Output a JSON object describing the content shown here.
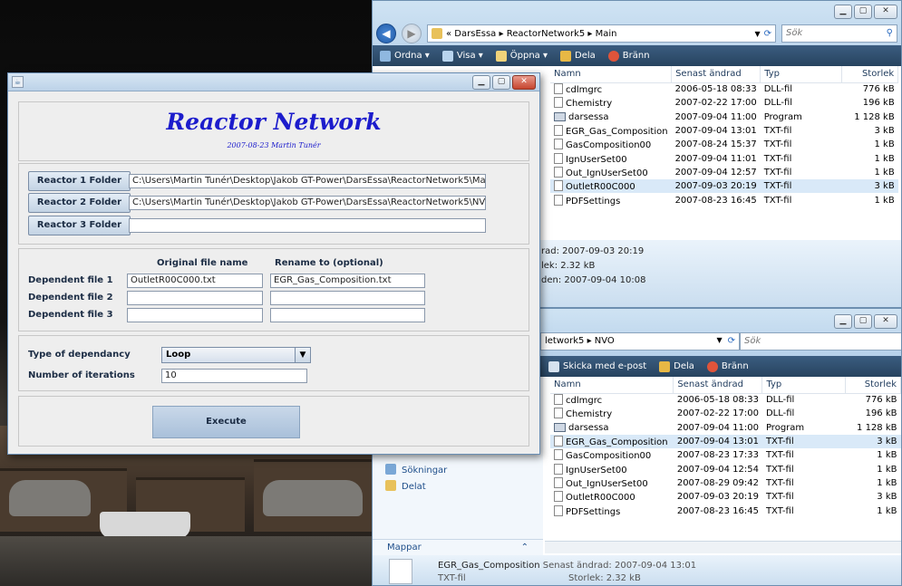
{
  "explorer_main": {
    "breadcrumb": "« DarsEssa ▸ ReactorNetwork5 ▸ Main",
    "search_placeholder": "Sök",
    "toolbar": [
      "Ordna ▾",
      "Visa ▾",
      "Öppna ▾",
      "Dela",
      "Bränn"
    ],
    "columns": [
      "Namn",
      "Senast ändrad",
      "Typ",
      "Storlek"
    ],
    "rows": [
      {
        "name": "cdlmgrc",
        "date": "2006-05-18 08:33",
        "type": "DLL-fil",
        "size": "776 kB"
      },
      {
        "name": "Chemistry",
        "date": "2007-02-22 17:00",
        "type": "DLL-fil",
        "size": "196 kB"
      },
      {
        "name": "darsessa",
        "date": "2007-09-04 11:00",
        "type": "Program",
        "size": "1 128 kB"
      },
      {
        "name": "EGR_Gas_Composition",
        "date": "2007-09-04 13:01",
        "type": "TXT-fil",
        "size": "3 kB"
      },
      {
        "name": "GasComposition00",
        "date": "2007-08-24 15:37",
        "type": "TXT-fil",
        "size": "1 kB"
      },
      {
        "name": "IgnUserSet00",
        "date": "2007-09-04 11:01",
        "type": "TXT-fil",
        "size": "1 kB"
      },
      {
        "name": "Out_IgnUserSet00",
        "date": "2007-09-04 12:57",
        "type": "TXT-fil",
        "size": "1 kB"
      },
      {
        "name": "OutletR00C000",
        "date": "2007-09-03 20:19",
        "type": "TXT-fil",
        "size": "3 kB"
      },
      {
        "name": "PDFSettings",
        "date": "2007-08-23 16:45",
        "type": "TXT-fil",
        "size": "1 kB"
      }
    ],
    "details": [
      "rad: 2007-09-03 20:19",
      "lek: 2.32 kB",
      "den: 2007-09-04 10:08"
    ]
  },
  "explorer_nvo": {
    "breadcrumb": "letwork5 ▸ NVO",
    "search_placeholder": "Sök",
    "toolbar": [
      "Skicka med e-post",
      "Dela",
      "Bränn"
    ],
    "columns": [
      "Namn",
      "Senast ändrad",
      "Typ",
      "Storlek"
    ],
    "rows": [
      {
        "name": "cdlmgrc",
        "date": "2006-05-18 08:33",
        "type": "DLL-fil",
        "size": "776 kB"
      },
      {
        "name": "Chemistry",
        "date": "2007-02-22 17:00",
        "type": "DLL-fil",
        "size": "196 kB"
      },
      {
        "name": "darsessa",
        "date": "2007-09-04 11:00",
        "type": "Program",
        "size": "1 128 kB"
      },
      {
        "name": "EGR_Gas_Composition",
        "date": "2007-09-04 13:01",
        "type": "TXT-fil",
        "size": "3 kB"
      },
      {
        "name": "GasComposition00",
        "date": "2007-08-23 17:33",
        "type": "TXT-fil",
        "size": "1 kB"
      },
      {
        "name": "IgnUserSet00",
        "date": "2007-09-04 12:54",
        "type": "TXT-fil",
        "size": "1 kB"
      },
      {
        "name": "Out_IgnUserSet00",
        "date": "2007-08-29 09:42",
        "type": "TXT-fil",
        "size": "1 kB"
      },
      {
        "name": "OutletR00C000",
        "date": "2007-09-03 20:19",
        "type": "TXT-fil",
        "size": "3 kB"
      },
      {
        "name": "PDFSettings",
        "date": "2007-08-23 16:45",
        "type": "TXT-fil",
        "size": "1 kB"
      }
    ],
    "nav_items": [
      "Sökningar",
      "Delat"
    ],
    "folders_label": "Mappar",
    "details": {
      "name": "EGR_Gas_Composition",
      "modified": "Senast ändrad: 2007-09-04 13:01",
      "type": "TXT-fil",
      "size": "Storlek: 2.32 kB"
    }
  },
  "app": {
    "title": "Reactor Network",
    "subtitle": "2007-08-23 Martin Tunér",
    "reactors": [
      {
        "button": "Reactor 1 Folder",
        "path": "C:\\Users\\Martin Tunér\\Desktop\\Jakob GT-Power\\DarsEssa\\ReactorNetwork5\\Main"
      },
      {
        "button": "Reactor 2 Folder",
        "path": "C:\\Users\\Martin Tunér\\Desktop\\Jakob GT-Power\\DarsEssa\\ReactorNetwork5\\NVO"
      },
      {
        "button": "Reactor 3 Folder",
        "path": ""
      }
    ],
    "col_original": "Original file name",
    "col_rename": "Rename to (optional)",
    "dependent": [
      {
        "label": "Dependent file 1",
        "original": "OutletR00C000.txt",
        "rename": "EGR_Gas_Composition.txt"
      },
      {
        "label": "Dependent file 2",
        "original": "",
        "rename": ""
      },
      {
        "label": "Dependent file 3",
        "original": "",
        "rename": ""
      }
    ],
    "dependency_label": "Type of dependancy",
    "dependency_value": "Loop",
    "iterations_label": "Number of iterations",
    "iterations_value": "10",
    "execute_label": "Execute"
  }
}
